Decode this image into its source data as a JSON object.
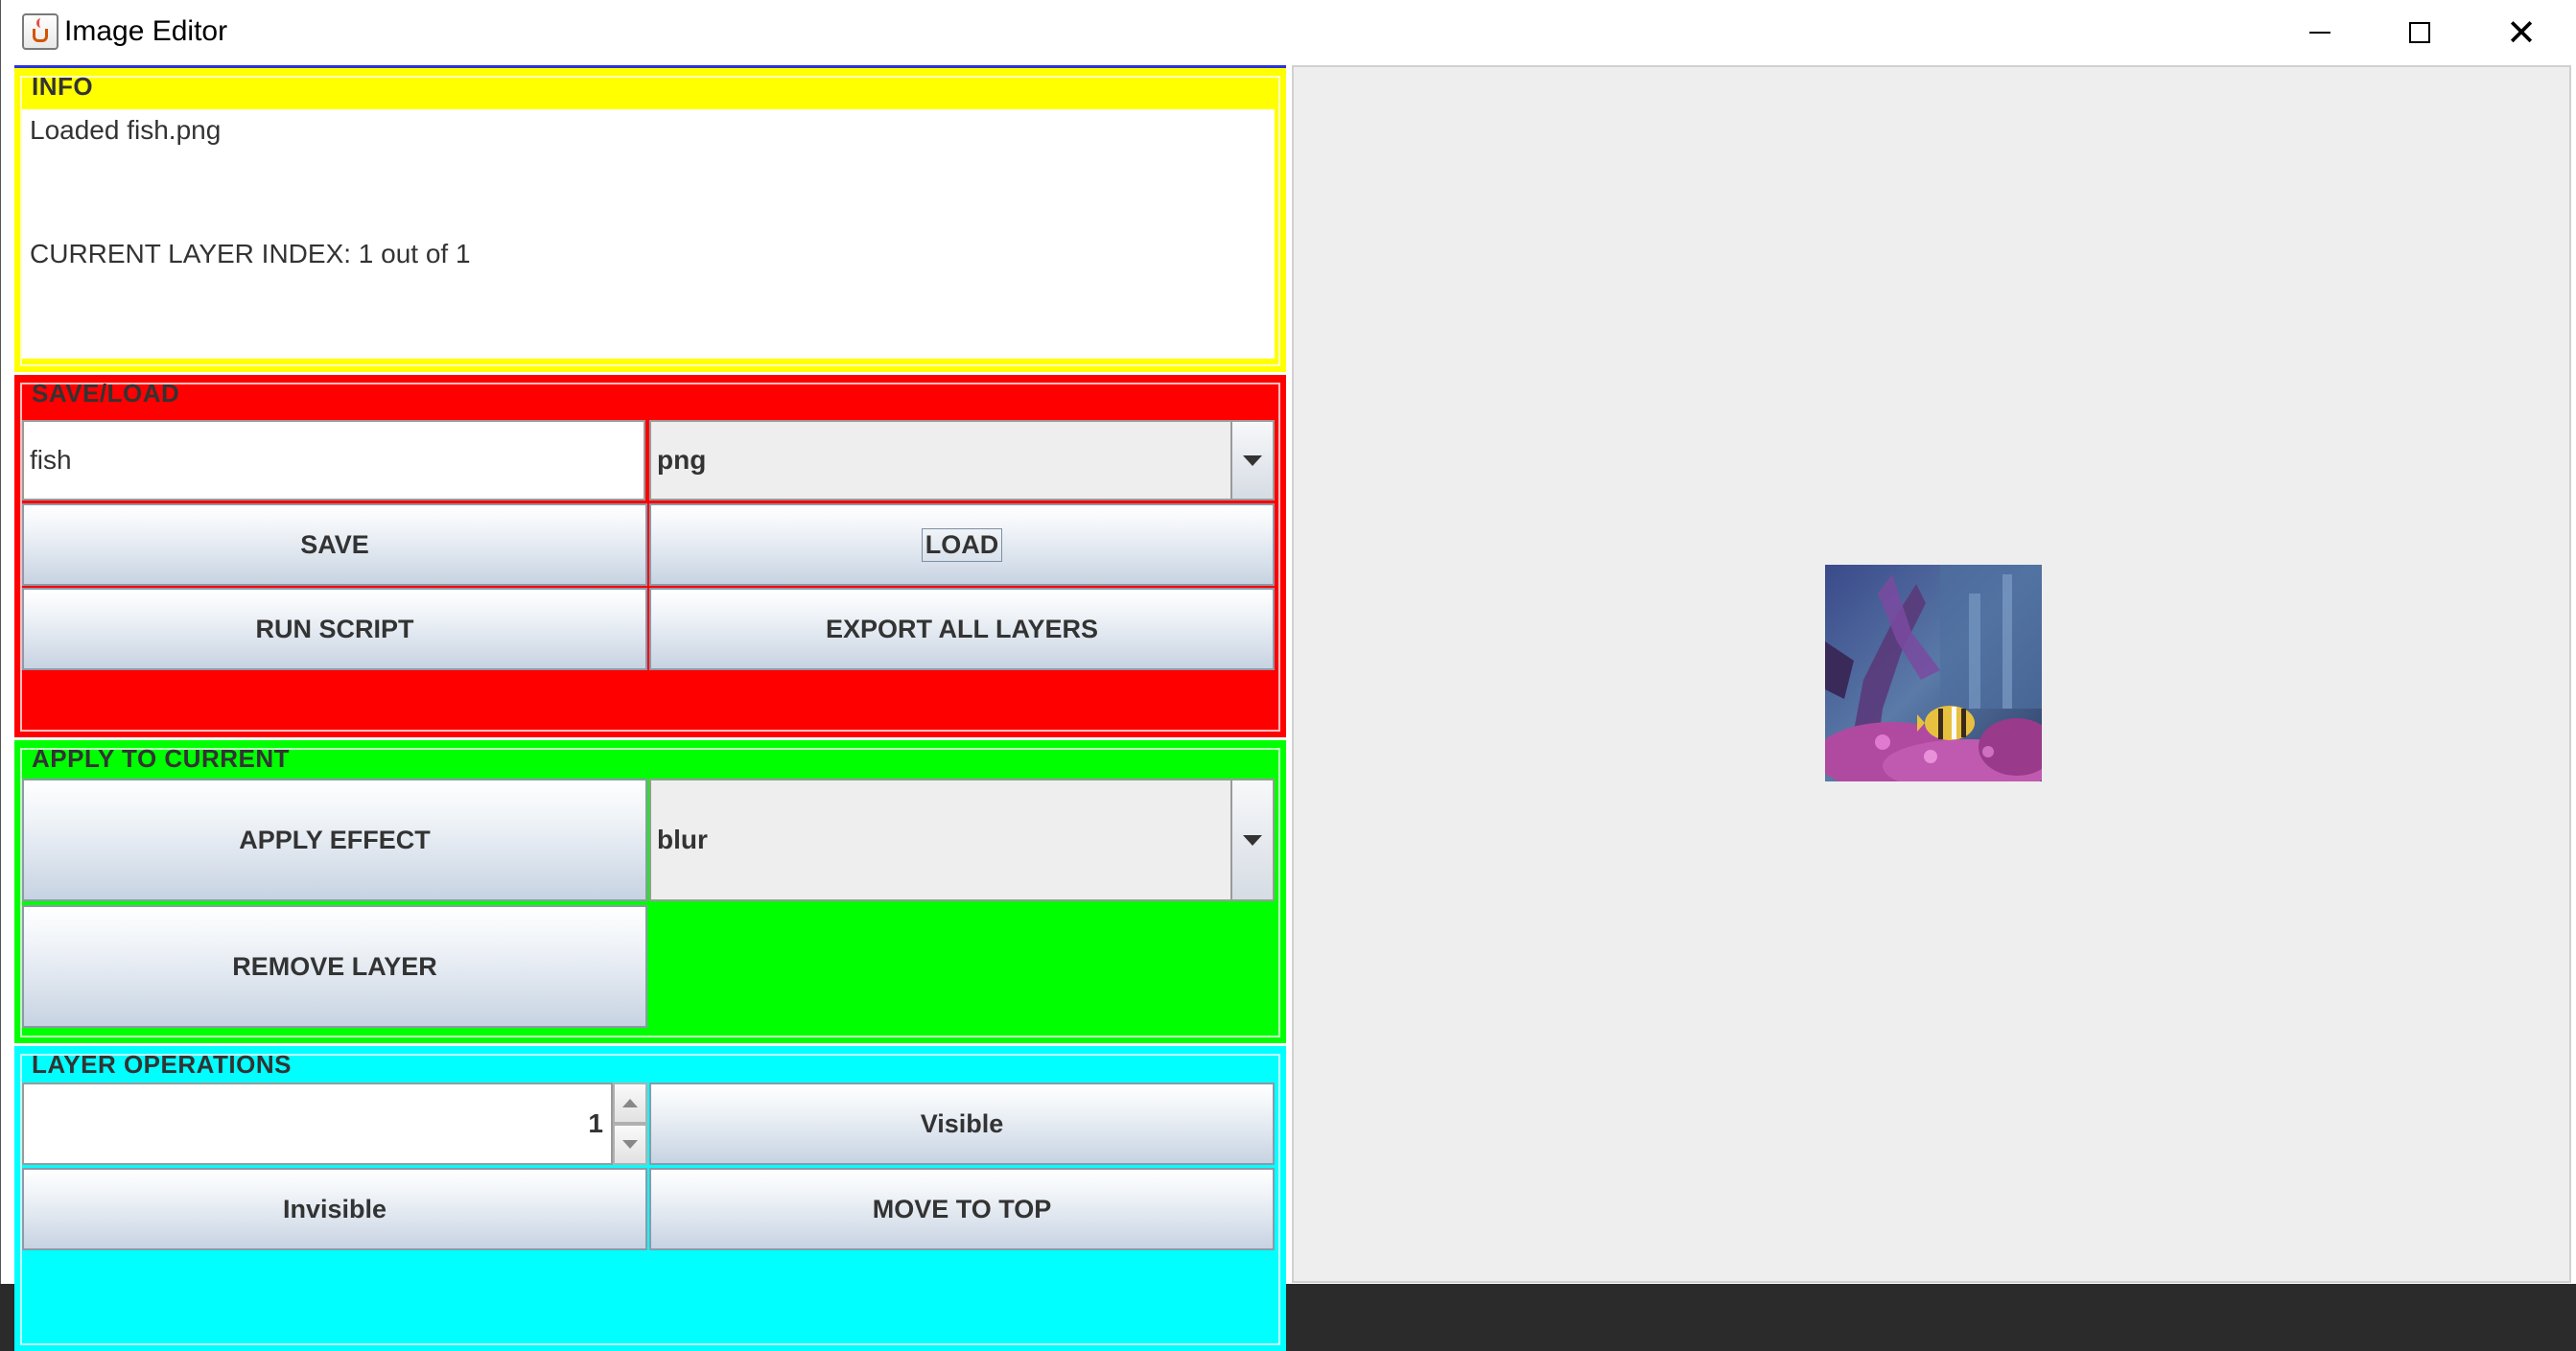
{
  "window": {
    "title": "Image Editor"
  },
  "info": {
    "title": "INFO",
    "message": "Loaded fish.png",
    "layer_index": "CURRENT LAYER INDEX: 1 out of 1"
  },
  "save_load": {
    "title": "SAVE/LOAD",
    "filename_value": "fish",
    "format_selected": "png",
    "save_label": "SAVE",
    "load_label": "LOAD",
    "run_script_label": "RUN SCRIPT",
    "export_all_label": "EXPORT ALL LAYERS"
  },
  "apply_current": {
    "title": "APPLY TO CURRENT",
    "apply_effect_label": "APPLY EFFECT",
    "effect_selected": "blur",
    "remove_layer_label": "REMOVE LAYER"
  },
  "layer_ops": {
    "title": "LAYER OPERATIONS",
    "layer_number": "1",
    "visible_label": "Visible",
    "invisible_label": "Invisible",
    "move_to_top_label": "MOVE TO TOP"
  },
  "colors": {
    "info_bg": "#ffff00",
    "save_load_bg": "#ff0000",
    "apply_bg": "#00ff00",
    "layer_ops_bg": "#00ffff",
    "canvas_bg": "#eeeeee"
  },
  "icons": [
    "java-app-icon",
    "minimize-icon",
    "maximize-icon",
    "close-icon",
    "dropdown-arrow-icon",
    "spinner-up-icon",
    "spinner-down-icon"
  ]
}
